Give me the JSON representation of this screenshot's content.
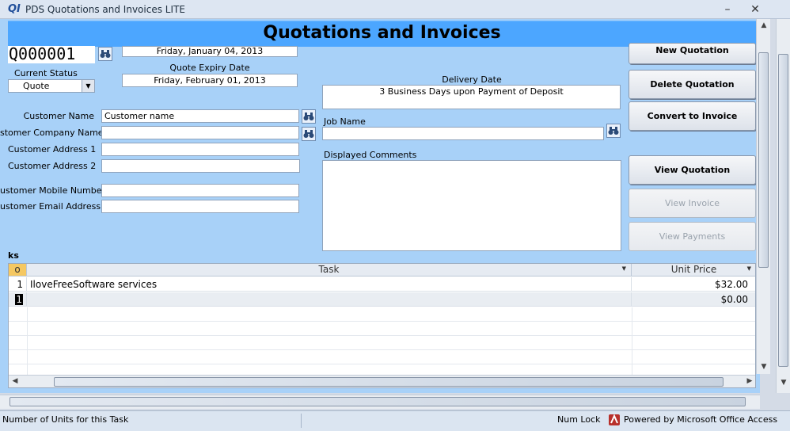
{
  "window": {
    "logo_text": "QI",
    "title": "PDS Quotations and Invoices LITE",
    "minimize": "–",
    "close": "✕"
  },
  "header": {
    "title": "Quotations and Invoices"
  },
  "quote": {
    "number": "Q000001",
    "date": "Friday, January 04, 2013",
    "expiry_label": "Quote Expiry Date",
    "expiry_value": "Friday, February 01, 2013",
    "status_label": "Current Status",
    "status_value": "Quote"
  },
  "customer": {
    "name_label": "Customer Name",
    "name_value": "Customer name",
    "company_label": "stomer Company Name",
    "company_value": "",
    "address1_label": "Customer Address 1",
    "address1_value": "",
    "address2_label": "Customer Address 2",
    "address2_value": "",
    "mobile_label": "ustomer Mobile Number",
    "mobile_value": "",
    "email_label": "ustomer Email Address",
    "email_value": ""
  },
  "delivery": {
    "label": "Delivery Date",
    "value": "3 Business Days upon Payment of Deposit"
  },
  "job": {
    "label": "Job Name",
    "value": ""
  },
  "comments": {
    "label": "Displayed Comments",
    "value": ""
  },
  "buttons": {
    "new_quotation": "New Quotation",
    "delete_quotation": "Delete Quotation",
    "convert_to_invoice": "Convert to Invoice",
    "view_quotation": "View Quotation",
    "view_invoice": "View Invoice",
    "view_payments": "View Payments"
  },
  "tasks": {
    "section_label": "ks",
    "columns": {
      "no": "o",
      "task": "Task",
      "unit_price": "Unit Price"
    },
    "rows": [
      {
        "no": "1",
        "task": "IloveFreeSoftware services",
        "unit_price": "$32.00"
      },
      {
        "no": "1",
        "task": "",
        "unit_price": "$0.00"
      }
    ]
  },
  "status": {
    "hint": "Number of Units for this Task",
    "num_lock": "Num Lock",
    "powered_by": "Powered by Microsoft Office Access"
  },
  "colors": {
    "header": "#4ca6ff",
    "form_background": "#a8d1f8"
  }
}
